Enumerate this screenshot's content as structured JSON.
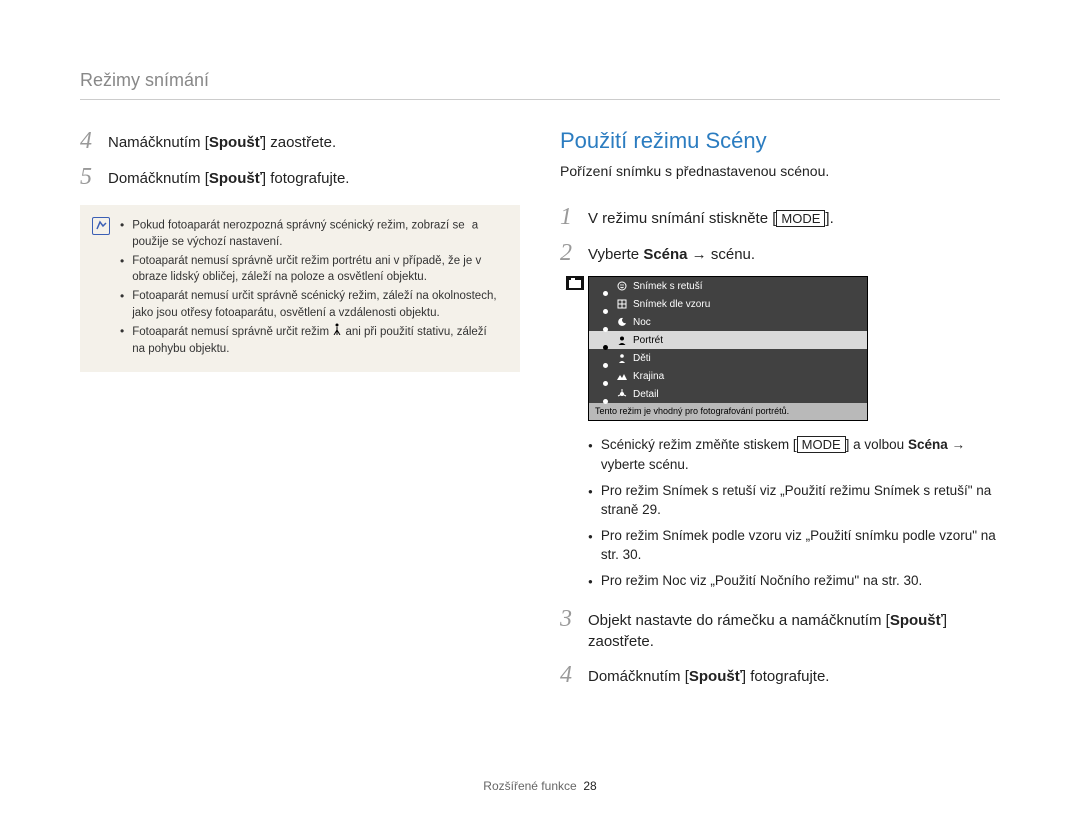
{
  "header": {
    "section": "Režimy snímání"
  },
  "left": {
    "step4": {
      "num": "4",
      "pre": "Namáčknutím [",
      "bold": "Spoušť",
      "post": "] zaostřete."
    },
    "step5": {
      "num": "5",
      "pre": "Domáčknutím [",
      "bold": "Spoušť",
      "post": "] fotografujte."
    },
    "info": {
      "b1a": "Pokud fotoaparát nerozpozná správný scénický režim, zobrazí se ",
      "b1b": " a použije se výchozí nastavení.",
      "b2": "Fotoaparát nemusí správně určit režim portrétu ani v případě, že je v obraze lidský obličej, záleží na poloze a osvětlení objektu.",
      "b3": "Fotoaparát nemusí určit správně scénický režim, záleží na okolnostech, jako jsou otřesy fotoaparátu, osvětlení a vzdálenosti objektu.",
      "b4a": "Fotoaparát nemusí správně určit režim ",
      "b4b": " ani při použití stativu, záleží na pohybu objektu."
    }
  },
  "right": {
    "heading": "Použití režimu Scény",
    "intro": "Pořízení snímku s přednastavenou scénou.",
    "step1": {
      "num": "1",
      "pre": "V režimu snímání stiskněte [",
      "key": "MODE",
      "post": "]."
    },
    "step2": {
      "num": "2",
      "pre": "Vyberte ",
      "bold": "Scéna",
      "arrow": " → ",
      "post": "scénu."
    },
    "scene": {
      "items": [
        {
          "label": "Snímek s retuší"
        },
        {
          "label": "Snímek dle vzoru"
        },
        {
          "label": "Noc"
        },
        {
          "label": "Portrét",
          "selected": true
        },
        {
          "label": "Děti"
        },
        {
          "label": "Krajina"
        },
        {
          "label": "Detail"
        }
      ],
      "tip": "Tento režim je vhodný pro fotografování portrétů."
    },
    "bullets": {
      "i1a": "Scénický režim změňte stiskem [",
      "i1key": "MODE",
      "i1b": "] a volbou ",
      "i1bold": "Scéna",
      "i1c": " → vyberte scénu.",
      "i2": "Pro režim Snímek s retuší viz „Použití režimu Snímek s retuší\" na straně 29.",
      "i3": "Pro režim Snímek podle vzoru viz „Použití snímku podle vzoru\" na str. 30.",
      "i4": "Pro režim Noc viz „Použití Nočního režimu\" na str. 30."
    },
    "step3": {
      "num": "3",
      "pre": "Objekt nastavte do rámečku a namáčknutím [",
      "bold": "Spoušť",
      "post": "] zaostřete."
    },
    "step4": {
      "num": "4",
      "pre": "Domáčknutím [",
      "bold": "Spoušť",
      "post": "] fotografujte."
    }
  },
  "footer": {
    "label": "Rozšířené funkce",
    "page": "28"
  }
}
